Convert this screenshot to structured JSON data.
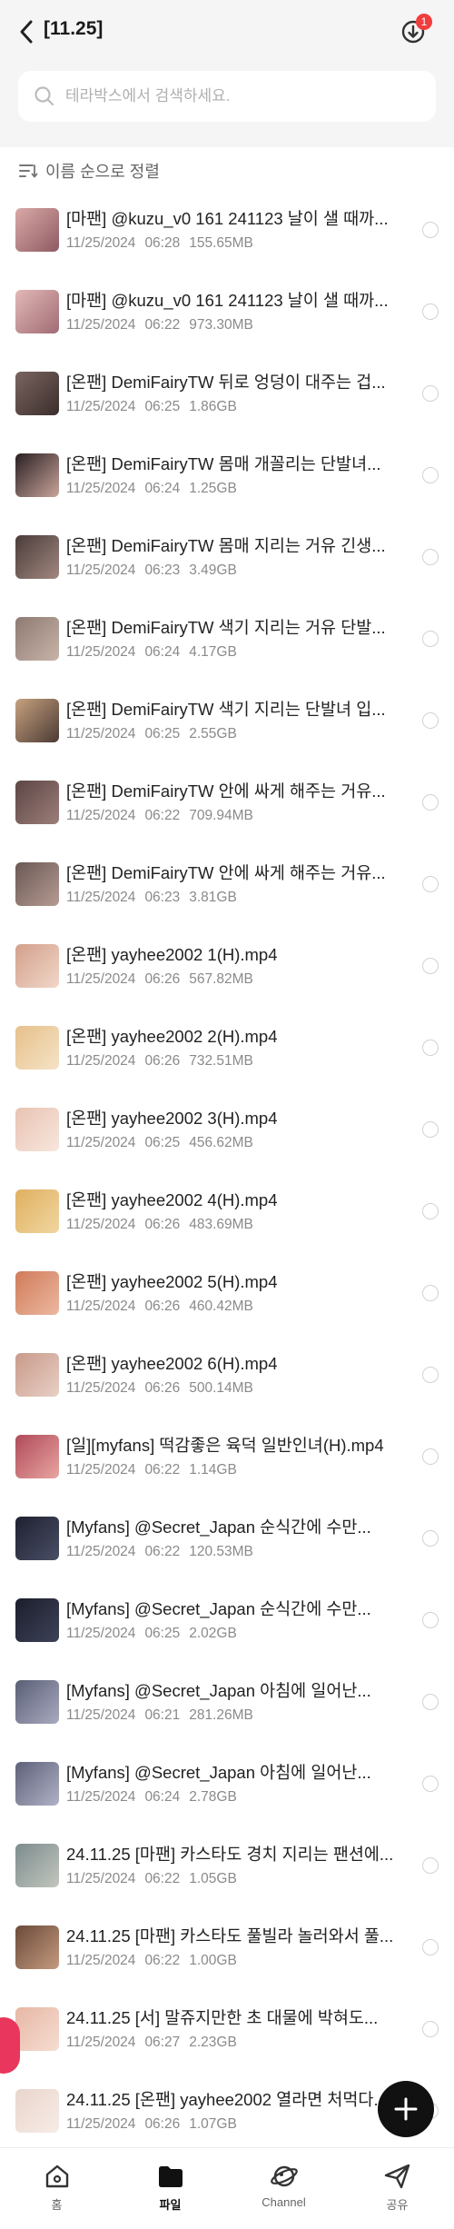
{
  "header": {
    "title": "[11.25]",
    "download_badge": "1"
  },
  "search": {
    "placeholder": "테라박스에서 검색하세요."
  },
  "sort": {
    "label": "이름 순으로 정렬"
  },
  "files": [
    {
      "name": "[마팬] @kuzu_v0 161 241123 날이 샐 때까...",
      "date": "11/25/2024",
      "time": "06:28",
      "size": "155.65MB",
      "thumb": [
        "#d9a9a6",
        "#8f5a63"
      ]
    },
    {
      "name": "[마팬] @kuzu_v0 161 241123 날이 샐 때까...",
      "date": "11/25/2024",
      "time": "06:22",
      "size": "973.30MB",
      "thumb": [
        "#e2b8b6",
        "#a06c74"
      ]
    },
    {
      "name": "[온팬] DemiFairyTW 뒤로 엉덩이 대주는 겁...",
      "date": "11/25/2024",
      "time": "06:25",
      "size": "1.86GB",
      "thumb": [
        "#7a6460",
        "#3b2e2b"
      ]
    },
    {
      "name": "[온팬] DemiFairyTW 몸매 개꼴리는 단발녀...",
      "date": "11/25/2024",
      "time": "06:24",
      "size": "1.25GB",
      "thumb": [
        "#2a1f22",
        "#c9a59a"
      ]
    },
    {
      "name": "[온팬] DemiFairyTW 몸매 지리는 거유 긴생...",
      "date": "11/25/2024",
      "time": "06:23",
      "size": "3.49GB",
      "thumb": [
        "#4a3c3a",
        "#a1877f"
      ]
    },
    {
      "name": "[온팬] DemiFairyTW 색기 지리는 거유 단발...",
      "date": "11/25/2024",
      "time": "06:24",
      "size": "4.17GB",
      "thumb": [
        "#8d7a72",
        "#c8b3a8"
      ]
    },
    {
      "name": "[온팬] DemiFairyTW 색기 지리는 단발녀 입...",
      "date": "11/25/2024",
      "time": "06:25",
      "size": "2.55GB",
      "thumb": [
        "#c7a27f",
        "#4b3a34"
      ]
    },
    {
      "name": "[온팬] DemiFairyTW 안에 싸게 해주는 거유...",
      "date": "11/25/2024",
      "time": "06:22",
      "size": "709.94MB",
      "thumb": [
        "#5c4646",
        "#9c7e78"
      ]
    },
    {
      "name": "[온팬] DemiFairyTW 안에 싸게 해주는 거유...",
      "date": "11/25/2024",
      "time": "06:23",
      "size": "3.81GB",
      "thumb": [
        "#6b5855",
        "#b59b92"
      ]
    },
    {
      "name": "[온팬] yayhee2002 1(H).mp4",
      "date": "11/25/2024",
      "time": "06:26",
      "size": "567.82MB",
      "thumb": [
        "#d2a08b",
        "#f1d6c8"
      ]
    },
    {
      "name": "[온팬] yayhee2002 2(H).mp4",
      "date": "11/25/2024",
      "time": "06:26",
      "size": "732.51MB",
      "thumb": [
        "#e6c08a",
        "#f5e3c6"
      ]
    },
    {
      "name": "[온팬] yayhee2002 3(H).mp4",
      "date": "11/25/2024",
      "time": "06:25",
      "size": "456.62MB",
      "thumb": [
        "#e9c3b3",
        "#f7e6dc"
      ]
    },
    {
      "name": "[온팬] yayhee2002 4(H).mp4",
      "date": "11/25/2024",
      "time": "06:26",
      "size": "483.69MB",
      "thumb": [
        "#e0b060",
        "#f0d6a0"
      ]
    },
    {
      "name": "[온팬] yayhee2002 5(H).mp4",
      "date": "11/25/2024",
      "time": "06:26",
      "size": "460.42MB",
      "thumb": [
        "#d07b5a",
        "#ecb8a0"
      ]
    },
    {
      "name": "[온팬] yayhee2002 6(H).mp4",
      "date": "11/25/2024",
      "time": "06:26",
      "size": "500.14MB",
      "thumb": [
        "#c99a8a",
        "#e8cfc5"
      ]
    },
    {
      "name": "[일][myfans] 떡감좋은 육덕 일반인녀(H).mp4",
      "date": "11/25/2024",
      "time": "06:22",
      "size": "1.14GB",
      "thumb": [
        "#b04a5a",
        "#e8a5a0"
      ]
    },
    {
      "name": "[Myfans] @Secret_Japan 순식간에 수만...",
      "date": "11/25/2024",
      "time": "06:22",
      "size": "120.53MB",
      "thumb": [
        "#1e2130",
        "#4a4e66"
      ]
    },
    {
      "name": "[Myfans] @Secret_Japan 순식간에 수만...",
      "date": "11/25/2024",
      "time": "06:25",
      "size": "2.02GB",
      "thumb": [
        "#1b1e2c",
        "#3e4258"
      ]
    },
    {
      "name": "[Myfans] @Secret_Japan 아침에 일어난...",
      "date": "11/25/2024",
      "time": "06:21",
      "size": "281.26MB",
      "thumb": [
        "#5a5f75",
        "#a9aac0"
      ]
    },
    {
      "name": "[Myfans] @Secret_Japan 아침에 일어난...",
      "date": "11/25/2024",
      "time": "06:24",
      "size": "2.78GB",
      "thumb": [
        "#5d6178",
        "#b0b1c6"
      ]
    },
    {
      "name": "24.11.25 [마팬] 카스타도 경치 지리는 팬션에...",
      "date": "11/25/2024",
      "time": "06:22",
      "size": "1.05GB",
      "thumb": [
        "#7d8c8e",
        "#c2c6bd"
      ]
    },
    {
      "name": "24.11.25 [마팬] 카스타도 풀빌라 놀러와서 풀...",
      "date": "11/25/2024",
      "time": "06:22",
      "size": "1.00GB",
      "thumb": [
        "#6b4a3a",
        "#c49a7e"
      ]
    },
    {
      "name": "24.11.25 [서] 말쥬지만한 초 대물에 박혀도...",
      "date": "11/25/2024",
      "time": "06:27",
      "size": "2.23GB",
      "thumb": [
        "#e7b7a5",
        "#f5ddd2"
      ]
    },
    {
      "name": "24.11.25 [온팬] yayhee2002 열라면 처먹다...",
      "date": "11/25/2024",
      "time": "06:26",
      "size": "1.07GB",
      "thumb": [
        "#e9d5cc",
        "#f7ece6"
      ]
    }
  ],
  "nav": [
    {
      "label": "홈",
      "icon": "home-icon",
      "active": false
    },
    {
      "label": "파일",
      "icon": "folder-icon",
      "active": true
    },
    {
      "label": "Channel",
      "icon": "planet-icon",
      "active": false
    },
    {
      "label": "공유",
      "icon": "send-icon",
      "active": false
    }
  ]
}
